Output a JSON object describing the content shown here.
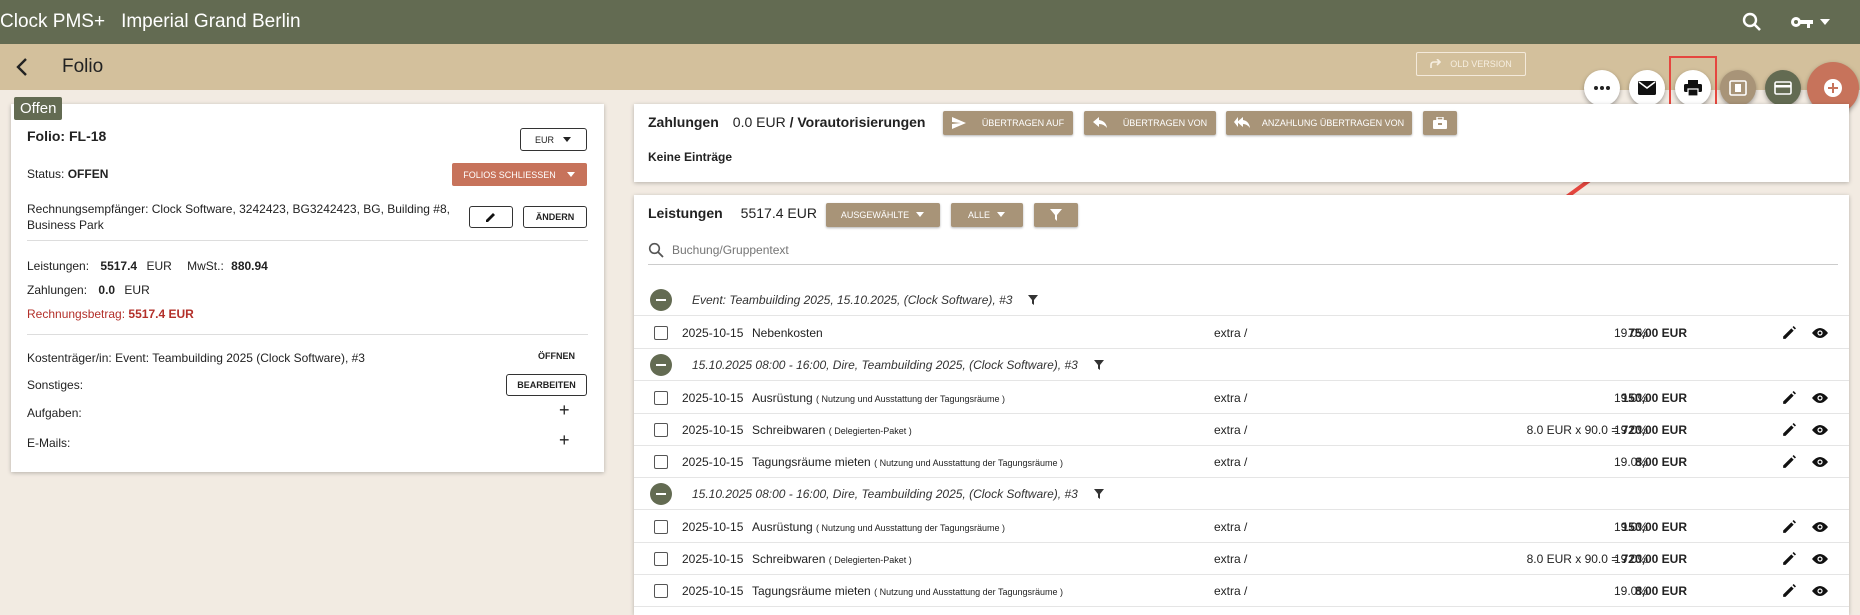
{
  "app": {
    "brand": "Clock PMS+",
    "hotel": "Imperial Grand Berlin"
  },
  "page": {
    "title": "Folio",
    "old_version": "OLD VERSION"
  },
  "status_badge": "Offen",
  "folio": {
    "title": "Folio: FL-18",
    "currency": "EUR",
    "status_label": "Status:",
    "status_value": "OFFEN",
    "close_button": "FOLIOS SCHLIESSEN",
    "recipient_label": "Rechnungsempfänger:",
    "recipient_line1": "Clock Software, 3242423, BG3242423, BG, Building #8,",
    "recipient_line2": "Business Park",
    "change_button": "ÄNDERN",
    "services_label": "Leistungen:",
    "services_value": "5517.4",
    "services_currency": "EUR",
    "vat_label": "MwSt.:",
    "vat_value": "880.94",
    "payments_label": "Zahlungen:",
    "payments_value": "0.0",
    "payments_currency": "EUR",
    "invoice_label": "Rechnungsbetrag:",
    "invoice_value": "5517.4 EUR",
    "cost_bearer_label": "Kostenträger/in:",
    "cost_bearer_value": "Event: Teambuilding 2025 (Clock Software), #3",
    "open_link": "ÖFFNEN",
    "other_label": "Sonstiges:",
    "edit_button": "BEARBEITEN",
    "tasks_label": "Aufgaben:",
    "emails_label": "E-Mails:",
    "plus": "+"
  },
  "payments": {
    "label": "Zahlungen",
    "amount": "0.0 EUR",
    "separator": "/",
    "preauth": "Vorautorisierungen",
    "transfer_to": "ÜBERTRAGEN AUF",
    "transfer_from": "ÜBERTRAGEN VON",
    "deposit_transfer": "ANZAHLUNG ÜBERTRAGEN VON",
    "empty": "Keine Einträge"
  },
  "services": {
    "label": "Leistungen",
    "amount": "5517.4 EUR",
    "selected": "AUSGEWÄHLTE",
    "all": "ALLE",
    "search_placeholder": "Buchung/Gruppentext",
    "groups": [
      {
        "title": "Event: Teambuilding 2025, 15.10.2025, (Clock Software), #3",
        "items": [
          {
            "date": "2025-10-15",
            "name": "Nebenkosten",
            "sub": "",
            "extra": "extra /",
            "qty": "",
            "amount": "75,00 EUR",
            "vat": "19.0%"
          }
        ]
      },
      {
        "title": "15.10.2025 08:00 - 16:00, Dire, Teambuilding 2025, (Clock Software), #3",
        "items": [
          {
            "date": "2025-10-15",
            "name": "Ausrüstung",
            "sub": "( Nutzung und Ausstattung der Tagungsräume )",
            "extra": "extra /",
            "qty": "",
            "amount": "150,00 EUR",
            "vat": "19.0%"
          },
          {
            "date": "2025-10-15",
            "name": "Schreibwaren",
            "sub": "( Delegierten-Paket )",
            "extra": "extra /",
            "qty": "8.0 EUR x 90.0 = ",
            "amount": "720,00 EUR",
            "vat": "19.0%"
          },
          {
            "date": "2025-10-15",
            "name": "Tagungsräume mieten",
            "sub": "( Nutzung und Ausstattung der Tagungsräume )",
            "extra": "extra /",
            "qty": "",
            "amount": "8,00 EUR",
            "vat": "19.0%"
          }
        ]
      },
      {
        "title": "15.10.2025 08:00 - 16:00, Dire, Teambuilding 2025, (Clock Software), #3",
        "items": [
          {
            "date": "2025-10-15",
            "name": "Ausrüstung",
            "sub": "( Nutzung und Ausstattung der Tagungsräume )",
            "extra": "extra /",
            "qty": "",
            "amount": "150,00 EUR",
            "vat": "19.0%"
          },
          {
            "date": "2025-10-15",
            "name": "Schreibwaren",
            "sub": "( Delegierten-Paket )",
            "extra": "extra /",
            "qty": "8.0 EUR x 90.0 = ",
            "amount": "720,00 EUR",
            "vat": "19.0%"
          },
          {
            "date": "2025-10-15",
            "name": "Tagungsräume mieten",
            "sub": "( Nutzung und Ausstattung der Tagungsräume )",
            "extra": "extra /",
            "qty": "",
            "amount": "8,00 EUR",
            "vat": "19.0%"
          }
        ]
      }
    ]
  },
  "colors": {
    "topbar": "#636b52",
    "subbar": "#d3c09c",
    "accent_red": "#c7735b",
    "tan": "#a89478",
    "highlight": "#e5463f"
  },
  "icons": [
    "search-icon",
    "key-icon",
    "back-arrow-icon",
    "more-icon",
    "mail-icon",
    "print-icon",
    "cash-icon",
    "credit-card-icon",
    "add-icon"
  ]
}
